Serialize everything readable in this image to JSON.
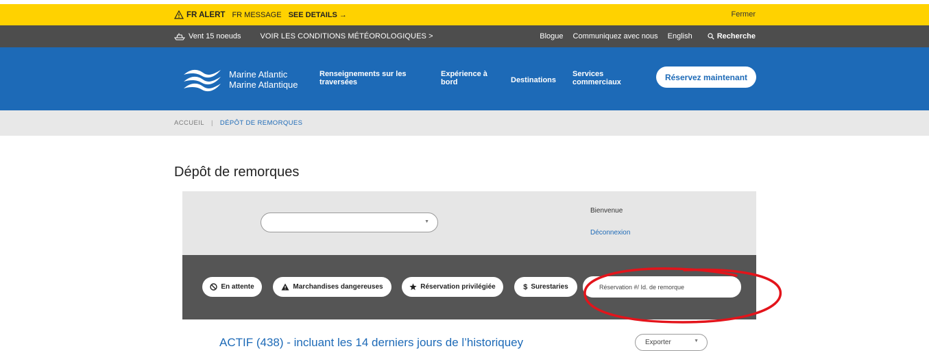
{
  "alert": {
    "title": "FR ALERT",
    "message": "FR MESSAGE",
    "details": "SEE DETAILS →",
    "close": "Fermer"
  },
  "utility": {
    "wind": "Vent 15 noeuds",
    "conditions": "VOIR LES CONDITIONS MÉTÉOROLOGIQUES  >",
    "blog": "Blogue",
    "contact": "Communiquez avec nous",
    "language": "English",
    "search": "Recherche"
  },
  "nav": {
    "logo_line1": "Marine Atlantic",
    "logo_line2": "Marine Atlantique",
    "item1_line1": "Renseignements sur les",
    "item1_line2": "traversées",
    "item2_line1": "Expérience à",
    "item2_line2": "bord",
    "item3_line1": "Destinations",
    "item4_line1": "Services",
    "item4_line2": "commerciaux",
    "reserve": "Réservez maintenant"
  },
  "breadcrumb": {
    "home": "ACCUEIL",
    "separator": "|",
    "current": "DÉPÔT DE REMORQUES"
  },
  "page_title": "Dépôt de remorques",
  "account": {
    "select_value": "",
    "welcome": "Bienvenue",
    "logout": "Déconnexion"
  },
  "filters": {
    "on_hold": "En attente",
    "dangerous": "Marchandises dangereuses",
    "priority": "Réservation privilégiée",
    "demurrage": "Surestaries",
    "search_placeholder": "Réservation #/ Id. de remorque"
  },
  "list": {
    "active_title": "ACTIF (438) - incluant les 14 derniers jours de l’historiquey",
    "export": "Exporter"
  },
  "colors": {
    "alert": "#ffd200",
    "utility": "#4d4d4d",
    "brand_blue": "#1d6ab7",
    "highlight": "#e3141b"
  }
}
